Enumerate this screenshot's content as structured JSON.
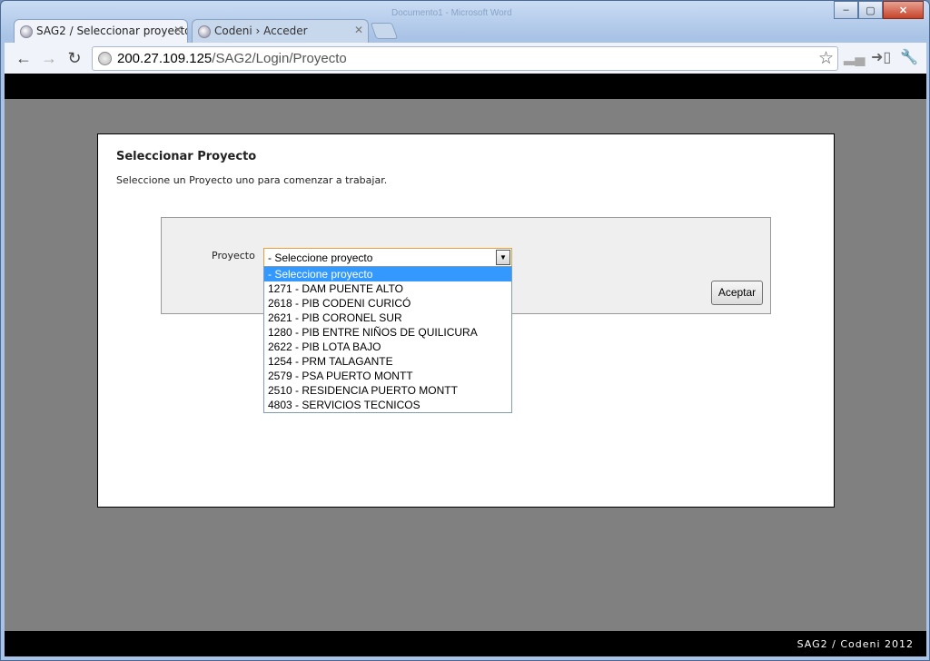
{
  "browser": {
    "background_titles": [
      "Documento1 - Microsoft Word"
    ],
    "tabs": [
      {
        "label": "SAG2 / Seleccionar proyecto",
        "active": true
      },
      {
        "label": "Codeni › Acceder",
        "active": false
      }
    ],
    "url_host": "200.27.109.125",
    "url_path": "/SAG2/Login/Proyecto",
    "window_buttons": {
      "minimize": "–",
      "maximize": "▢",
      "close": "✕"
    }
  },
  "page": {
    "heading": "Seleccionar Proyecto",
    "description": "Seleccione un Proyecto uno para comenzar a trabajar.",
    "form": {
      "label": "Proyecto",
      "selected_value": "- Seleccione proyecto",
      "options": [
        "- Seleccione proyecto",
        "1271 - DAM PUENTE ALTO",
        "2618 - PIB CODENI CURICÓ",
        "2621 - PIB CORONEL SUR",
        "1280 - PIB ENTRE NIÑOS DE QUILICURA",
        "2622 - PIB LOTA BAJO",
        "1254 - PRM TALAGANTE",
        "2579 - PSA PUERTO MONTT",
        "2510 - RESIDENCIA PUERTO MONTT",
        "4803 - SERVICIOS TECNICOS"
      ],
      "highlighted_index": 0,
      "submit_label": "Aceptar"
    },
    "footer": "SAG2 / Codeni 2012"
  },
  "colors": {
    "page_background": "#808080",
    "bars": "#000000",
    "highlight": "#3399ff",
    "select_focus_border": "#e3a13f"
  }
}
